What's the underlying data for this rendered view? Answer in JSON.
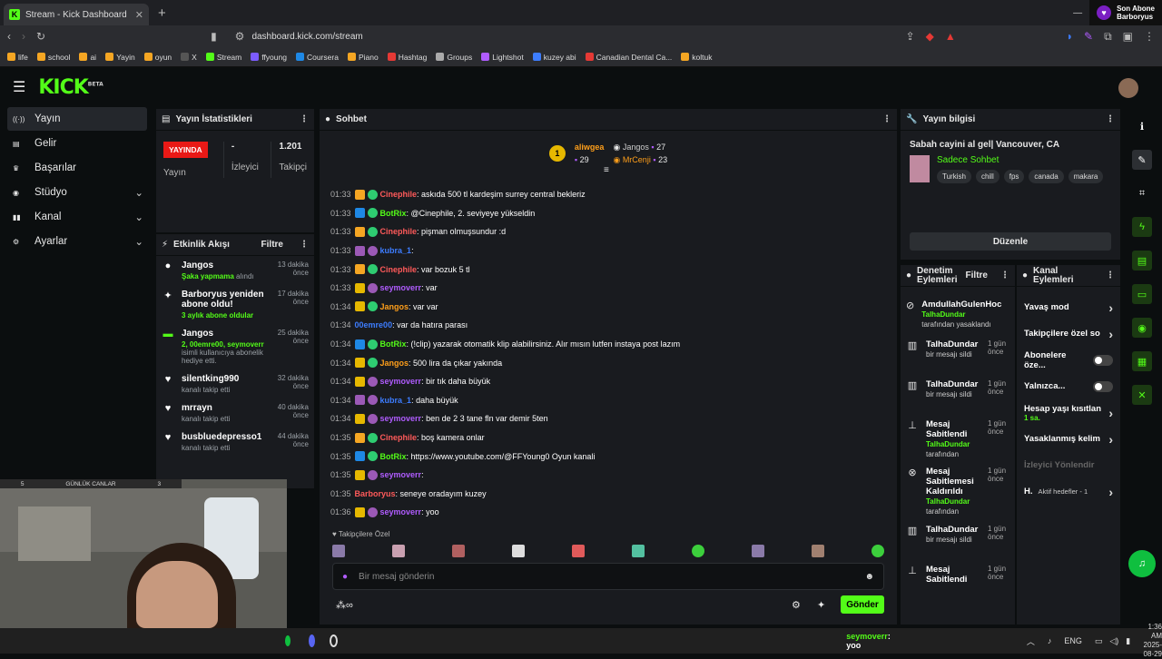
{
  "browser": {
    "tab_title": "Stream - Kick Dashboard",
    "url": "dashboard.kick.com/stream",
    "notification": {
      "line1": "Son Abone",
      "line2": "Barboryus"
    },
    "bookmarks": [
      "life",
      "school",
      "ai",
      "Yayin",
      "oyun",
      "X",
      "Stream",
      "ffyoung",
      "Coursera",
      "Piano",
      "Hashtag",
      "Groups",
      "Lightshot",
      "kuzey abi",
      "Canadian Dental Ca...",
      "koltuk"
    ]
  },
  "logo": "KICK",
  "logo_beta": "BETA",
  "nav": [
    {
      "label": "Yayın",
      "icon": "broadcast-icon"
    },
    {
      "label": "Gelir",
      "icon": "revenue-icon"
    },
    {
      "label": "Başarılar",
      "icon": "trophy-icon"
    },
    {
      "label": "Stüdyo",
      "icon": "studio-icon"
    },
    {
      "label": "Kanal",
      "icon": "channel-icon"
    },
    {
      "label": "Ayarlar",
      "icon": "gear-icon"
    }
  ],
  "stats": {
    "title": "Yayın İstatistikleri",
    "live_badge": "YAYINDA",
    "live_label": "Yayın",
    "viewers_value": "-",
    "viewers_label": "İzleyici",
    "followers_value": "1.201",
    "followers_label": "Takipçi"
  },
  "feed": {
    "title": "Etkinlik Akışı",
    "filter": "Filtre",
    "items": [
      {
        "name": "Jangos",
        "detail_hl": "Şaka yapmama",
        "detail": " alındı",
        "time": "13 dakika önce"
      },
      {
        "name": "Barboryus yeniden abone oldu!",
        "detail_hl": "3 aylık abone oldular",
        "detail": "",
        "time": "17 dakika önce"
      },
      {
        "name": "Jangos",
        "detail_hl": "2, 00emre00, seymoverr",
        "detail": " isimli kullanıcıya abonelik hediye etti.",
        "time": "25 dakika önce"
      },
      {
        "name": "silentking990",
        "detail_hl": "",
        "detail": "kanalı takip etti",
        "time": "32 dakika önce"
      },
      {
        "name": "mrrayn",
        "detail_hl": "",
        "detail": "kanalı takip etti",
        "time": "40 dakika önce"
      },
      {
        "name": "busbluedepresso1",
        "detail_hl": "",
        "detail": "kanalı takip etti",
        "time": "44 dakika önce"
      }
    ]
  },
  "chat": {
    "title": "Sohbet",
    "leaders": [
      {
        "rank": "1",
        "name": "aliwgea",
        "count": "29"
      },
      {
        "name": "Jangos",
        "count": "27"
      },
      {
        "name": "MrCenji",
        "count": "23"
      }
    ],
    "messages": [
      {
        "time": "01:33",
        "user": "Cinephile",
        "color": "#ff5a5a",
        "badge": "#f5a623",
        "text": ": askıda 500 tl kardeşim surrey central bekleriz"
      },
      {
        "time": "01:33",
        "user": "BotRix",
        "color": "#53fc18",
        "badge": "#1e88e5",
        "text": ": @Cinephile, 2. seviyeye yükseldin"
      },
      {
        "time": "01:33",
        "user": "Cinephile",
        "color": "#ff5a5a",
        "badge": "#f5a623",
        "text": ": pişman olmuşsundur :d"
      },
      {
        "time": "01:33",
        "user": "kubra_1",
        "color": "#3d7dff",
        "badge": "#9b59b6",
        "text": ":"
      },
      {
        "time": "01:33",
        "user": "Cinephile",
        "color": "#ff5a5a",
        "badge": "#f5a623",
        "text": ": var bozuk 5 tl"
      },
      {
        "time": "01:33",
        "user": "seymoverr",
        "color": "#b05cff",
        "badge": "#e6b800",
        "text": ": var"
      },
      {
        "time": "01:34",
        "user": "Jangos",
        "color": "#ff9f1a",
        "badge": "#e6b800",
        "text": ": var var"
      },
      {
        "time": "01:34",
        "user": "00emre00",
        "color": "#3d7dff",
        "badge": "",
        "text": ": var da hatıra parası"
      },
      {
        "time": "01:34",
        "user": "BotRix",
        "color": "#53fc18",
        "badge": "#1e88e5",
        "text": ": (!clip) yazarak otomatik klip alabilirsiniz. Alır mısın lutfen instaya post lazım"
      },
      {
        "time": "01:34",
        "user": "Jangos",
        "color": "#ff9f1a",
        "badge": "#e6b800",
        "text": ": 500 lira da çıkar yakında"
      },
      {
        "time": "01:34",
        "user": "seymoverr",
        "color": "#b05cff",
        "badge": "#e6b800",
        "text": ": bir tık daha büyük"
      },
      {
        "time": "01:34",
        "user": "kubra_1",
        "color": "#3d7dff",
        "badge": "#9b59b6",
        "text": ": daha büyük"
      },
      {
        "time": "01:34",
        "user": "seymoverr",
        "color": "#b05cff",
        "badge": "#e6b800",
        "text": ": ben de 2 3 tane fln var demir 5ten"
      },
      {
        "time": "01:35",
        "user": "Cinephile",
        "color": "#ff5a5a",
        "badge": "#f5a623",
        "text": ": boş kamera onlar"
      },
      {
        "time": "01:35",
        "user": "BotRix",
        "color": "#53fc18",
        "badge": "#1e88e5",
        "text": ": https://www.youtube.com/@FFYoung0 Oyun kanali"
      },
      {
        "time": "01:35",
        "user": "seymoverr",
        "color": "#b05cff",
        "badge": "#e6b800",
        "text": ":"
      },
      {
        "time": "01:35",
        "user": "Barboryus",
        "color": "#ff5a5a",
        "badge": "",
        "text": ": seneye oradayım kuzey"
      },
      {
        "time": "01:36",
        "user": "seymoverr",
        "color": "#b05cff",
        "badge": "#e6b800",
        "text": ": yoo"
      }
    ],
    "emote_label": "Takipçilere Özel",
    "input_placeholder": "Bir mesaj gönderin",
    "send": "Gönder"
  },
  "info": {
    "title": "Yayın bilgisi",
    "stream_title": "Sabah cayini al gel| Vancouver, CA",
    "category": "Sadece Sohbet",
    "tags": [
      "Turkish",
      "chill",
      "fps",
      "canada",
      "makara"
    ],
    "edit": "Düzenle"
  },
  "mod": {
    "title": "Denetim Eylemleri",
    "filter": "Filtre",
    "items": [
      {
        "icon": "ban-icon",
        "title": "AmdullahGulenHoc",
        "by": "TalhaDundar",
        "action": "tarafından yasaklandı",
        "time": ""
      },
      {
        "icon": "trash-icon",
        "title": "TalhaDundar",
        "by": "",
        "action": "bir mesajı sildi",
        "time": "1 gün önce"
      },
      {
        "icon": "trash-icon",
        "title": "TalhaDundar",
        "by": "",
        "action": "bir mesajı sildi",
        "time": "1 gün önce"
      },
      {
        "icon": "pin-icon",
        "title": "Mesaj Sabitlendi",
        "by": "TalhaDundar",
        "action": "tarafından",
        "time": "1 gün önce"
      },
      {
        "icon": "unpin-icon",
        "title": "Mesaj Sabitlemesi Kaldırıldı",
        "by": "TalhaDundar",
        "action": "tarafından",
        "time": "1 gün önce"
      },
      {
        "icon": "trash-icon",
        "title": "TalhaDundar",
        "by": "",
        "action": "bir mesajı sildi",
        "time": "1 gün önce"
      },
      {
        "icon": "pin-icon",
        "title": "Mesaj Sabitlendi",
        "by": "",
        "action": "",
        "time": "1 gün önce"
      }
    ]
  },
  "kanal": {
    "title": "Kanal Eylemleri",
    "items": [
      {
        "label": "Yavaş mod",
        "type": "chev"
      },
      {
        "label": "Takipçilere özel so",
        "type": "chev"
      },
      {
        "label": "Abonelere öze...",
        "type": "toggle"
      },
      {
        "label": "Yalnızca...",
        "type": "toggle"
      },
      {
        "label": "Hesap yaşı kısıtlan",
        "type": "chev",
        "sub": "1 sa."
      },
      {
        "label": "Yasaklanmış kelim",
        "type": "chev"
      },
      {
        "label": "İzleyici Yönlendir",
        "type": "disabled"
      },
      {
        "label": "H.",
        "type": "chev",
        "sub2": "Aktif hedefler - 1"
      }
    ]
  },
  "webcam_bar": {
    "left": "5",
    "label": "GÜNLÜK CANLAR",
    "right": "3"
  },
  "taskbar": {
    "chat_user": "seymoverr",
    "chat_text": ": yoo",
    "lang": "ENG",
    "time": "1:36 AM",
    "date": "2025-08-29"
  }
}
